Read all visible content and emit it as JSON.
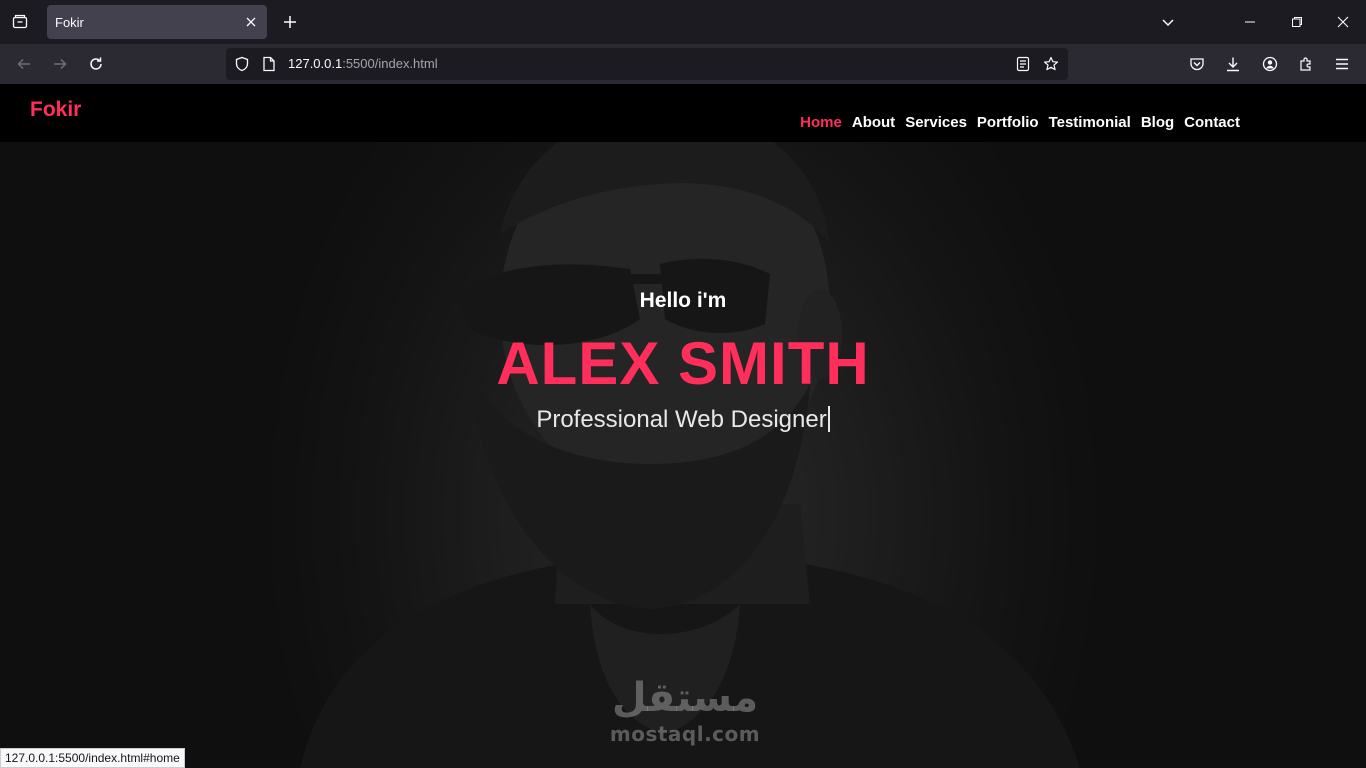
{
  "browser": {
    "tab_title": "Fokir",
    "url_host": "127.0.0.1",
    "url_rest": ":5500/index.html",
    "status_url": "127.0.0.1:5500/index.html#home"
  },
  "site": {
    "logo": "Fokir",
    "menu": [
      "Home",
      "About",
      "Services",
      "Portfolio",
      "Testimonial",
      "Blog",
      "Contact"
    ],
    "active_menu": "Home"
  },
  "hero": {
    "greeting": "Hello i'm",
    "name": "ALEX SMITH",
    "role": "Professional Web Designer"
  },
  "watermark": {
    "arabic": "مستقل",
    "latin": "mostaql.com"
  },
  "colors": {
    "accent": "#ff2e5b",
    "header_bg": "#000000",
    "tab_bg": "#42414d",
    "toolbar_bg": "#2b2a33"
  }
}
